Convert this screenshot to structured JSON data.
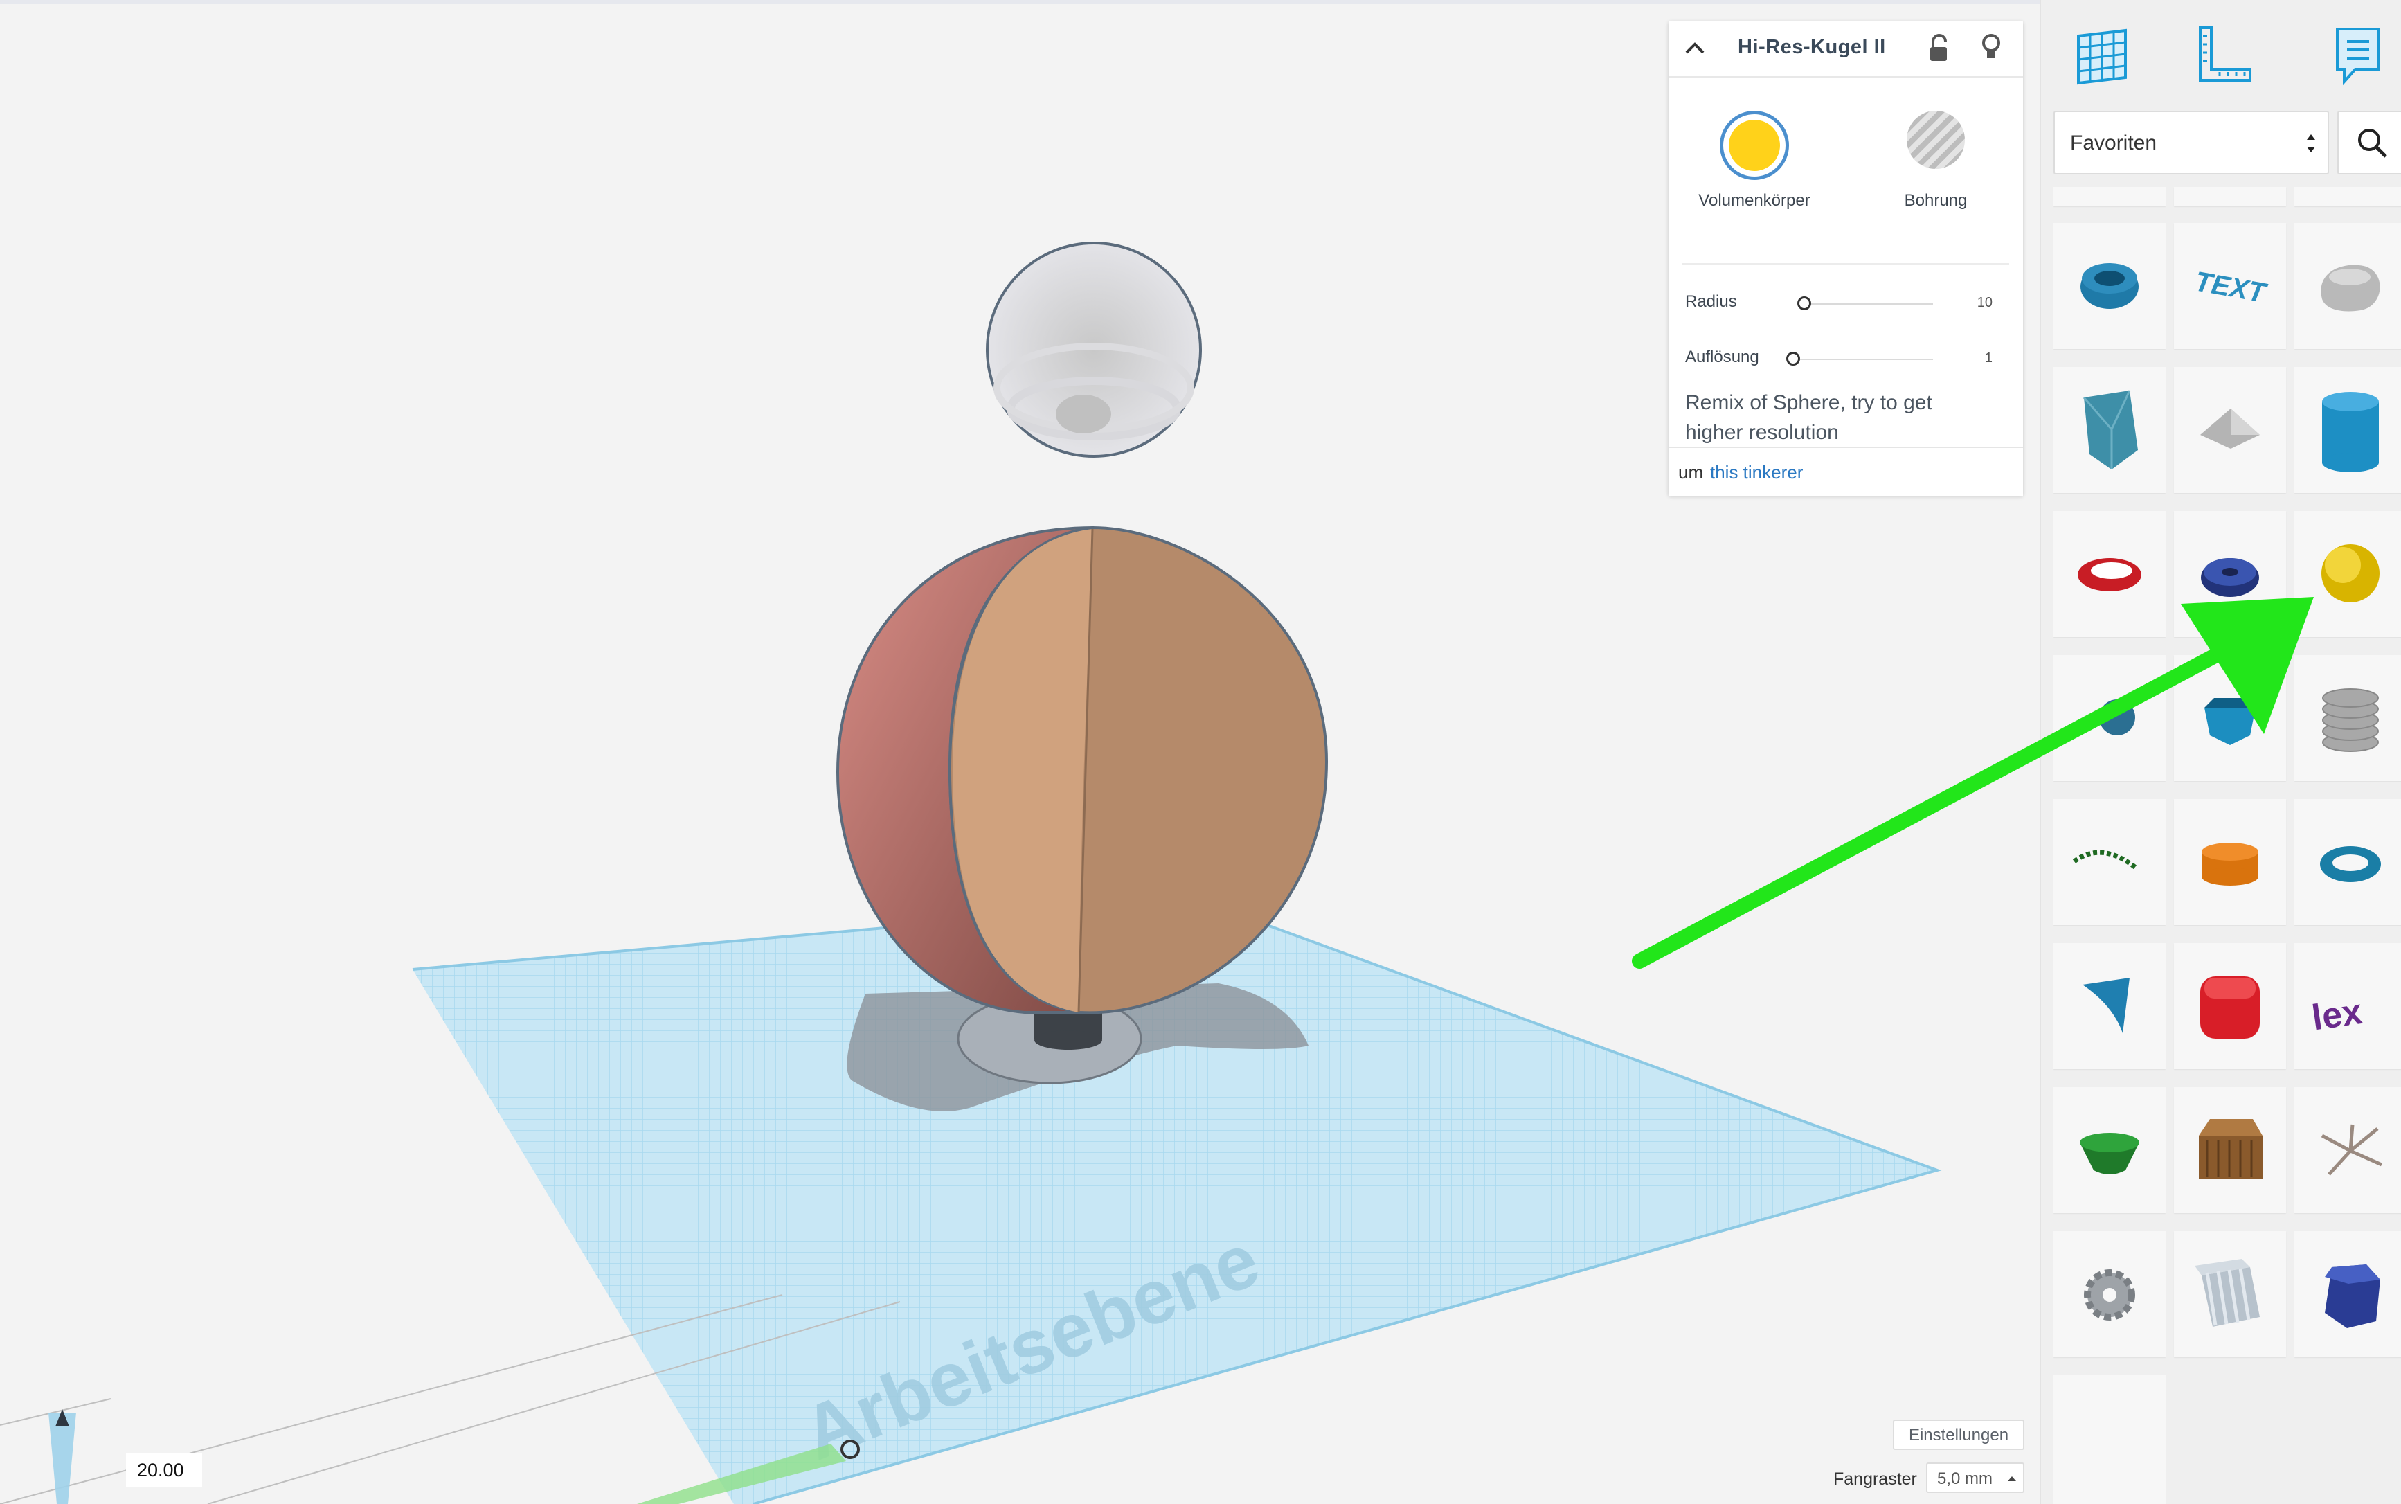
{
  "inspector": {
    "title": "Hi-Res-Kugel II",
    "solid_label": "Volumenkörper",
    "hole_label": "Bohrung",
    "solid_color": "#FFD21A",
    "params": [
      {
        "label": "Radius",
        "value": "10"
      },
      {
        "label": "Auflösung",
        "value": "1"
      }
    ],
    "description": "Remix of Sphere, try to get higher resolution",
    "by_prefix": "um",
    "by_link": "this tinkerer",
    "icons": {
      "collapse": "chevron-up-icon",
      "lock": "unlock-icon",
      "bulb": "lightbulb-icon"
    }
  },
  "workplane": {
    "label": "Arbeitsebene",
    "dimension_value": "20.00",
    "settings_label": "Einstellungen",
    "snap_label": "Fangraster",
    "snap_value": "5,0 mm"
  },
  "sidebar": {
    "toolbar_icons": [
      "workplane-grid-icon",
      "ruler-icon",
      "notes-icon"
    ],
    "category": "Favoriten",
    "search_icon": "search-icon",
    "shapes": [
      "blue-tire",
      "text-3d",
      "gray-pebble",
      "twisted-vase",
      "gray-diamond",
      "blue-cylinder",
      "red-ring",
      "blue-wheel",
      "yellow-sphere",
      "blue-gear-partial",
      "blue-hex-cup",
      "gray-coil",
      "green-arc",
      "orange-cylinder",
      "blue-torus",
      "blue-wedge",
      "red-rounded-box",
      "purple-tex",
      "green-bowl",
      "wooden-crate",
      "white-spikes",
      "gray-gear",
      "striped-cube",
      "blue-hex-prism"
    ]
  },
  "colors": {
    "accent_blue": "#1aa0d6",
    "arrow_green": "#22e61a",
    "link_blue": "#2a78c2"
  }
}
